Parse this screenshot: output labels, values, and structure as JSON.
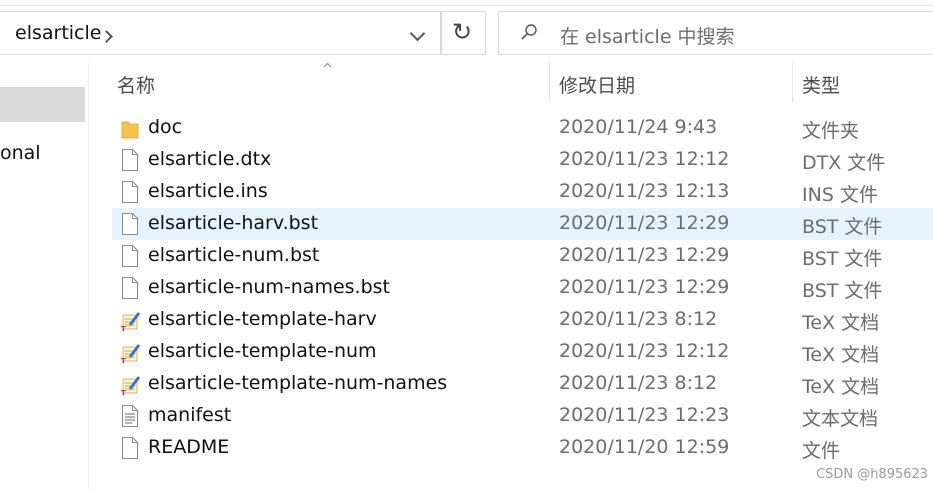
{
  "address_bar": {
    "crumb": "elsarticle"
  },
  "search": {
    "placeholder": "在 elsarticle 中搜索"
  },
  "nav": {
    "partial_label": "onal"
  },
  "columns": {
    "name": "名称",
    "date": "修改日期",
    "type": "类型"
  },
  "files": [
    {
      "icon": "folder-icon",
      "name": "doc",
      "date": "2020/11/24 9:43",
      "type": "文件夹"
    },
    {
      "icon": "file-icon",
      "name": "elsarticle.dtx",
      "date": "2020/11/23 12:12",
      "type": "DTX 文件"
    },
    {
      "icon": "file-icon",
      "name": "elsarticle.ins",
      "date": "2020/11/23 12:13",
      "type": "INS 文件"
    },
    {
      "icon": "file-icon",
      "name": "elsarticle-harv.bst",
      "date": "2020/11/23 12:29",
      "type": "BST 文件",
      "highlighted": true
    },
    {
      "icon": "file-icon",
      "name": "elsarticle-num.bst",
      "date": "2020/11/23 12:29",
      "type": "BST 文件"
    },
    {
      "icon": "file-icon",
      "name": "elsarticle-num-names.bst",
      "date": "2020/11/23 12:29",
      "type": "BST 文件"
    },
    {
      "icon": "tex-file-icon",
      "name": "elsarticle-template-harv",
      "date": "2020/11/23 8:12",
      "type": "TeX 文档"
    },
    {
      "icon": "tex-file-icon",
      "name": "elsarticle-template-num",
      "date": "2020/11/23 12:12",
      "type": "TeX 文档"
    },
    {
      "icon": "tex-file-icon",
      "name": "elsarticle-template-num-names",
      "date": "2020/11/23 8:12",
      "type": "TeX 文档"
    },
    {
      "icon": "text-file-icon",
      "name": "manifest",
      "date": "2020/11/23 12:23",
      "type": "文本文档"
    },
    {
      "icon": "file-icon",
      "name": "README",
      "date": "2020/11/20 12:59",
      "type": "文件"
    }
  ],
  "watermark": "CSDN @h895623",
  "colors": {
    "selection": "#e5f3ff",
    "nav_selection": "#d9d9d9",
    "folder": "#f5c34a"
  }
}
